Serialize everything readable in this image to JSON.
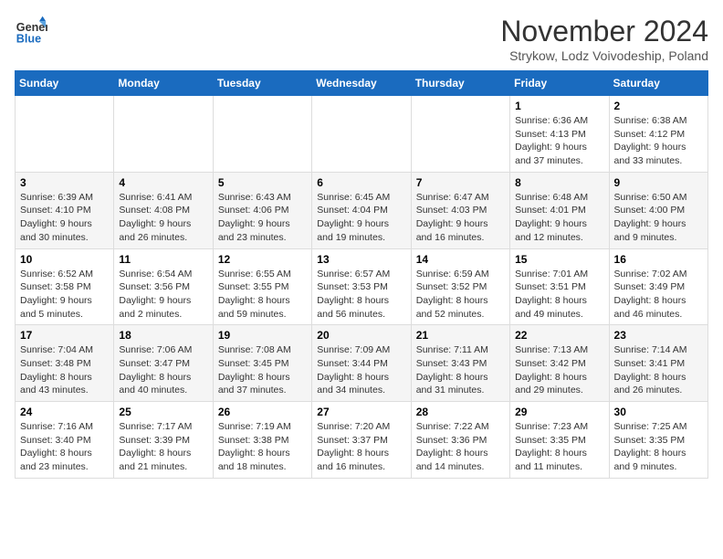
{
  "header": {
    "logo_line1": "General",
    "logo_line2": "Blue",
    "month_title": "November 2024",
    "subtitle": "Strykow, Lodz Voivodeship, Poland"
  },
  "days_of_week": [
    "Sunday",
    "Monday",
    "Tuesday",
    "Wednesday",
    "Thursday",
    "Friday",
    "Saturday"
  ],
  "weeks": [
    [
      {
        "day": "",
        "info": ""
      },
      {
        "day": "",
        "info": ""
      },
      {
        "day": "",
        "info": ""
      },
      {
        "day": "",
        "info": ""
      },
      {
        "day": "",
        "info": ""
      },
      {
        "day": "1",
        "info": "Sunrise: 6:36 AM\nSunset: 4:13 PM\nDaylight: 9 hours and 37 minutes."
      },
      {
        "day": "2",
        "info": "Sunrise: 6:38 AM\nSunset: 4:12 PM\nDaylight: 9 hours and 33 minutes."
      }
    ],
    [
      {
        "day": "3",
        "info": "Sunrise: 6:39 AM\nSunset: 4:10 PM\nDaylight: 9 hours and 30 minutes."
      },
      {
        "day": "4",
        "info": "Sunrise: 6:41 AM\nSunset: 4:08 PM\nDaylight: 9 hours and 26 minutes."
      },
      {
        "day": "5",
        "info": "Sunrise: 6:43 AM\nSunset: 4:06 PM\nDaylight: 9 hours and 23 minutes."
      },
      {
        "day": "6",
        "info": "Sunrise: 6:45 AM\nSunset: 4:04 PM\nDaylight: 9 hours and 19 minutes."
      },
      {
        "day": "7",
        "info": "Sunrise: 6:47 AM\nSunset: 4:03 PM\nDaylight: 9 hours and 16 minutes."
      },
      {
        "day": "8",
        "info": "Sunrise: 6:48 AM\nSunset: 4:01 PM\nDaylight: 9 hours and 12 minutes."
      },
      {
        "day": "9",
        "info": "Sunrise: 6:50 AM\nSunset: 4:00 PM\nDaylight: 9 hours and 9 minutes."
      }
    ],
    [
      {
        "day": "10",
        "info": "Sunrise: 6:52 AM\nSunset: 3:58 PM\nDaylight: 9 hours and 5 minutes."
      },
      {
        "day": "11",
        "info": "Sunrise: 6:54 AM\nSunset: 3:56 PM\nDaylight: 9 hours and 2 minutes."
      },
      {
        "day": "12",
        "info": "Sunrise: 6:55 AM\nSunset: 3:55 PM\nDaylight: 8 hours and 59 minutes."
      },
      {
        "day": "13",
        "info": "Sunrise: 6:57 AM\nSunset: 3:53 PM\nDaylight: 8 hours and 56 minutes."
      },
      {
        "day": "14",
        "info": "Sunrise: 6:59 AM\nSunset: 3:52 PM\nDaylight: 8 hours and 52 minutes."
      },
      {
        "day": "15",
        "info": "Sunrise: 7:01 AM\nSunset: 3:51 PM\nDaylight: 8 hours and 49 minutes."
      },
      {
        "day": "16",
        "info": "Sunrise: 7:02 AM\nSunset: 3:49 PM\nDaylight: 8 hours and 46 minutes."
      }
    ],
    [
      {
        "day": "17",
        "info": "Sunrise: 7:04 AM\nSunset: 3:48 PM\nDaylight: 8 hours and 43 minutes."
      },
      {
        "day": "18",
        "info": "Sunrise: 7:06 AM\nSunset: 3:47 PM\nDaylight: 8 hours and 40 minutes."
      },
      {
        "day": "19",
        "info": "Sunrise: 7:08 AM\nSunset: 3:45 PM\nDaylight: 8 hours and 37 minutes."
      },
      {
        "day": "20",
        "info": "Sunrise: 7:09 AM\nSunset: 3:44 PM\nDaylight: 8 hours and 34 minutes."
      },
      {
        "day": "21",
        "info": "Sunrise: 7:11 AM\nSunset: 3:43 PM\nDaylight: 8 hours and 31 minutes."
      },
      {
        "day": "22",
        "info": "Sunrise: 7:13 AM\nSunset: 3:42 PM\nDaylight: 8 hours and 29 minutes."
      },
      {
        "day": "23",
        "info": "Sunrise: 7:14 AM\nSunset: 3:41 PM\nDaylight: 8 hours and 26 minutes."
      }
    ],
    [
      {
        "day": "24",
        "info": "Sunrise: 7:16 AM\nSunset: 3:40 PM\nDaylight: 8 hours and 23 minutes."
      },
      {
        "day": "25",
        "info": "Sunrise: 7:17 AM\nSunset: 3:39 PM\nDaylight: 8 hours and 21 minutes."
      },
      {
        "day": "26",
        "info": "Sunrise: 7:19 AM\nSunset: 3:38 PM\nDaylight: 8 hours and 18 minutes."
      },
      {
        "day": "27",
        "info": "Sunrise: 7:20 AM\nSunset: 3:37 PM\nDaylight: 8 hours and 16 minutes."
      },
      {
        "day": "28",
        "info": "Sunrise: 7:22 AM\nSunset: 3:36 PM\nDaylight: 8 hours and 14 minutes."
      },
      {
        "day": "29",
        "info": "Sunrise: 7:23 AM\nSunset: 3:35 PM\nDaylight: 8 hours and 11 minutes."
      },
      {
        "day": "30",
        "info": "Sunrise: 7:25 AM\nSunset: 3:35 PM\nDaylight: 8 hours and 9 minutes."
      }
    ]
  ]
}
